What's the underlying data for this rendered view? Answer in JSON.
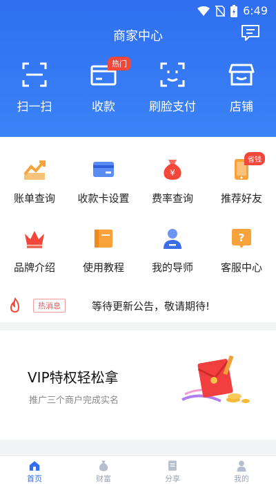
{
  "status": {
    "time": "6:49"
  },
  "header": {
    "title": "商家中心"
  },
  "quick_actions": [
    {
      "label": "扫一扫",
      "icon": "scan-icon"
    },
    {
      "label": "收款",
      "icon": "card-icon",
      "badge": "热门"
    },
    {
      "label": "刷脸支付",
      "icon": "face-pay-icon"
    },
    {
      "label": "店铺",
      "icon": "store-icon"
    }
  ],
  "grid": [
    {
      "label": "账单查询",
      "icon": "bill-chart-icon"
    },
    {
      "label": "收款卡设置",
      "icon": "bank-card-icon"
    },
    {
      "label": "费率查询",
      "icon": "money-bag-icon"
    },
    {
      "label": "推荐好友",
      "icon": "phone-icon",
      "badge": "省钱"
    },
    {
      "label": "品牌介绍",
      "icon": "crown-icon"
    },
    {
      "label": "使用教程",
      "icon": "book-icon"
    },
    {
      "label": "我的导师",
      "icon": "mentor-icon"
    },
    {
      "label": "客服中心",
      "icon": "help-icon"
    }
  ],
  "news": {
    "tag": "热消息",
    "text": "等待更新公告，敬请期待!"
  },
  "vip": {
    "title": "VIP特权轻松拿",
    "subtitle": "推广三个商户完成实名"
  },
  "tabs": [
    {
      "label": "首页",
      "icon": "home-icon",
      "active": true
    },
    {
      "label": "财富",
      "icon": "wealth-icon",
      "active": false
    },
    {
      "label": "分享",
      "icon": "share-icon",
      "active": false
    },
    {
      "label": "我的",
      "icon": "profile-icon",
      "active": false
    }
  ],
  "colors": {
    "primary": "#2f6ff0",
    "badge": "#f4473b",
    "orange": "#f7a23b"
  }
}
